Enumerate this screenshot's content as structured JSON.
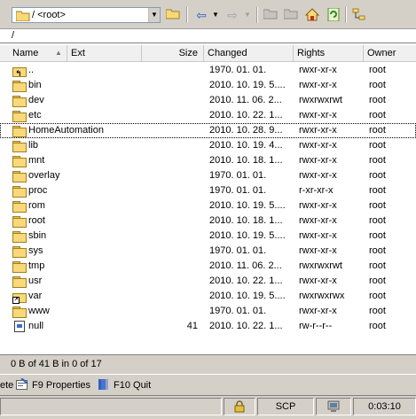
{
  "toolbar": {
    "path_combo_value": "/ <root>",
    "buttons": [
      {
        "name": "open-directory-icon",
        "glyph": "📂"
      },
      {
        "name": "back-icon",
        "glyph": "⇦"
      },
      {
        "name": "forward-icon",
        "glyph": "⇨"
      },
      {
        "name": "parent-directory-icon",
        "glyph": "▣"
      },
      {
        "name": "root-directory-icon",
        "glyph": "▣"
      },
      {
        "name": "home-directory-icon",
        "glyph": "⌂"
      },
      {
        "name": "refresh-icon",
        "glyph": "⟳"
      },
      {
        "name": "tree-view-icon",
        "glyph": "☷"
      }
    ]
  },
  "path_bar": {
    "value": "/"
  },
  "columns": {
    "name": "Name",
    "ext": "Ext",
    "size": "Size",
    "changed": "Changed",
    "rights": "Rights",
    "owner": "Owner"
  },
  "files": [
    {
      "icon": "up",
      "name": "..",
      "size": "",
      "changed": "1970. 01. 01.",
      "rights": "rwxr-xr-x",
      "owner": "root"
    },
    {
      "icon": "folder",
      "name": "bin",
      "size": "",
      "changed": "2010. 10. 19. 5....",
      "rights": "rwxr-xr-x",
      "owner": "root"
    },
    {
      "icon": "folder",
      "name": "dev",
      "size": "",
      "changed": "2010. 11. 06. 2...",
      "rights": "rwxrwxrwt",
      "owner": "root"
    },
    {
      "icon": "folder",
      "name": "etc",
      "size": "",
      "changed": "2010. 10. 22. 1...",
      "rights": "rwxr-xr-x",
      "owner": "root"
    },
    {
      "icon": "folder",
      "name": "HomeAutomation",
      "size": "",
      "changed": "2010. 10. 28. 9...",
      "rights": "rwxr-xr-x",
      "owner": "root"
    },
    {
      "icon": "folder",
      "name": "lib",
      "size": "",
      "changed": "2010. 10. 19. 4...",
      "rights": "rwxr-xr-x",
      "owner": "root"
    },
    {
      "icon": "folder",
      "name": "mnt",
      "size": "",
      "changed": "2010. 10. 18. 1...",
      "rights": "rwxr-xr-x",
      "owner": "root"
    },
    {
      "icon": "folder",
      "name": "overlay",
      "size": "",
      "changed": "1970. 01. 01.",
      "rights": "rwxr-xr-x",
      "owner": "root"
    },
    {
      "icon": "folder",
      "name": "proc",
      "size": "",
      "changed": "1970. 01. 01.",
      "rights": "r-xr-xr-x",
      "owner": "root"
    },
    {
      "icon": "folder",
      "name": "rom",
      "size": "",
      "changed": "2010. 10. 19. 5....",
      "rights": "rwxr-xr-x",
      "owner": "root"
    },
    {
      "icon": "folder",
      "name": "root",
      "size": "",
      "changed": "2010. 10. 18. 1...",
      "rights": "rwxr-xr-x",
      "owner": "root"
    },
    {
      "icon": "folder",
      "name": "sbin",
      "size": "",
      "changed": "2010. 10. 19. 5....",
      "rights": "rwxr-xr-x",
      "owner": "root"
    },
    {
      "icon": "folder",
      "name": "sys",
      "size": "",
      "changed": "1970. 01. 01.",
      "rights": "rwxr-xr-x",
      "owner": "root"
    },
    {
      "icon": "folder",
      "name": "tmp",
      "size": "",
      "changed": "2010. 11. 06. 2...",
      "rights": "rwxrwxrwt",
      "owner": "root"
    },
    {
      "icon": "folder",
      "name": "usr",
      "size": "",
      "changed": "2010. 10. 22. 1...",
      "rights": "rwxr-xr-x",
      "owner": "root"
    },
    {
      "icon": "link",
      "name": "var",
      "size": "",
      "changed": "2010. 10. 19. 5....",
      "rights": "rwxrwxrwx",
      "owner": "root"
    },
    {
      "icon": "folder",
      "name": "www",
      "size": "",
      "changed": "1970. 01. 01.",
      "rights": "rwxr-xr-x",
      "owner": "root"
    },
    {
      "icon": "file",
      "name": "null",
      "size": "41",
      "changed": "2010. 10. 22. 1...",
      "rights": "rw-r--r--",
      "owner": "root"
    }
  ],
  "focused_row": 4,
  "status": {
    "text": "0 B of 41 B in 0 of 17"
  },
  "fkeys": {
    "partial": "ete",
    "f9": "F9 Properties",
    "f10": "F10 Quit"
  },
  "bottom": {
    "protocol": "SCP",
    "time": "0:03:10"
  }
}
